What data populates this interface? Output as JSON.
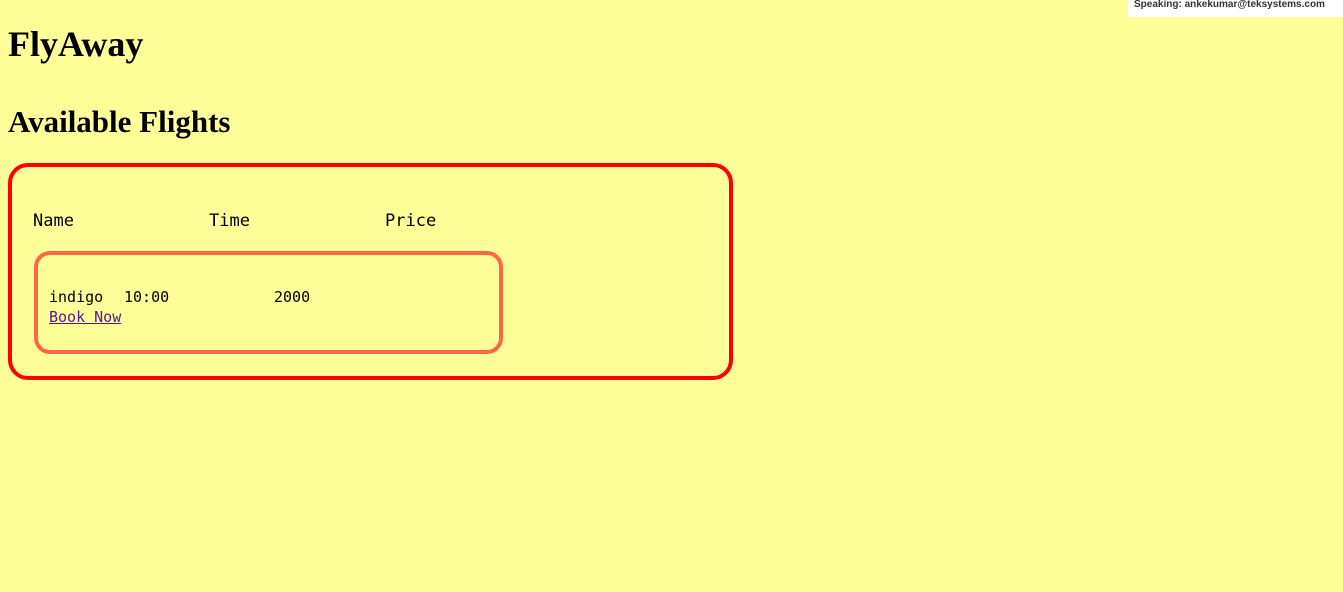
{
  "banner": {
    "speaking": "Speaking: ankekumar@teksystems.com"
  },
  "app": {
    "title": "FlyAway"
  },
  "flights": {
    "heading": "Available Flights",
    "columns": [
      "Name",
      "Time",
      "Price"
    ],
    "rows": [
      {
        "name": "indigo",
        "time": "10:00",
        "price": "2000",
        "action_label": "Book Now"
      }
    ]
  },
  "colors": {
    "background": "#ffff99",
    "panel_border": "#ff0000",
    "card_border": "#ff6644",
    "link": "#551a8b"
  }
}
